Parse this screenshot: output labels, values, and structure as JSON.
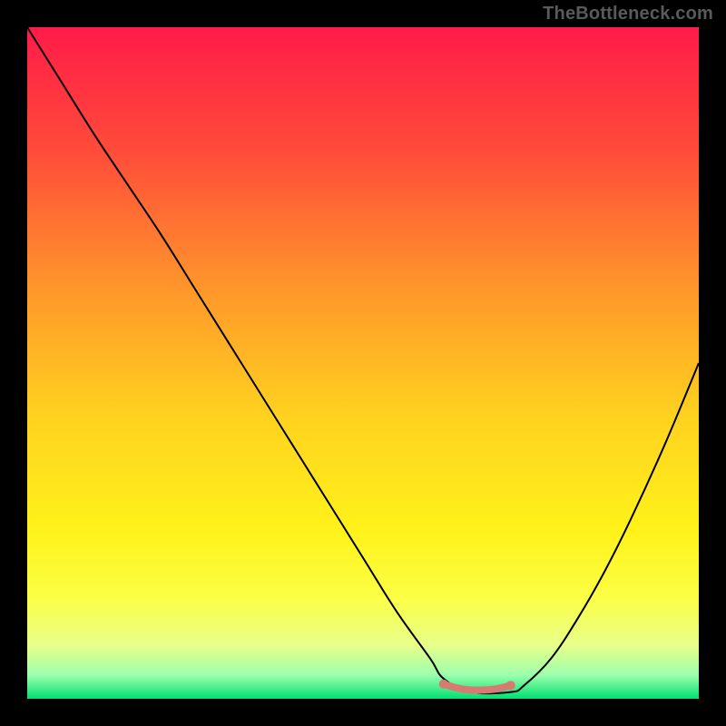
{
  "watermark": "TheBottleneck.com",
  "chart_data": {
    "type": "line",
    "title": "",
    "xlabel": "",
    "ylabel": "",
    "xlim": [
      0,
      100
    ],
    "ylim": [
      0,
      100
    ],
    "background": {
      "type": "vertical-gradient",
      "stops": [
        {
          "offset": 0.0,
          "color": "#ff1b49"
        },
        {
          "offset": 0.18,
          "color": "#ff4a3a"
        },
        {
          "offset": 0.4,
          "color": "#ff9a2a"
        },
        {
          "offset": 0.58,
          "color": "#ffd21f"
        },
        {
          "offset": 0.75,
          "color": "#fff21a"
        },
        {
          "offset": 0.85,
          "color": "#fbff45"
        },
        {
          "offset": 0.92,
          "color": "#e8ff8a"
        },
        {
          "offset": 0.965,
          "color": "#9cffad"
        },
        {
          "offset": 1.0,
          "color": "#00e070"
        }
      ]
    },
    "series": [
      {
        "name": "bottleneck-curve",
        "color": "#000000",
        "width": 2,
        "x": [
          0,
          5,
          10,
          15,
          20,
          25,
          30,
          35,
          40,
          45,
          50,
          55,
          60,
          62,
          66,
          72,
          74,
          78,
          82,
          86,
          90,
          95,
          100
        ],
        "y": [
          100,
          92,
          84,
          76.5,
          69,
          61,
          53,
          45,
          37,
          29,
          21,
          13,
          6,
          3,
          1,
          1,
          2,
          6,
          12,
          19,
          27,
          38,
          50
        ]
      }
    ],
    "highlight": {
      "name": "optimal-range",
      "color": "#d77a72",
      "width": 8,
      "x": [
        62,
        64,
        66,
        68,
        70,
        72
      ],
      "y": [
        2.2,
        1.6,
        1.3,
        1.3,
        1.5,
        2.0
      ],
      "endpoints": true
    }
  }
}
